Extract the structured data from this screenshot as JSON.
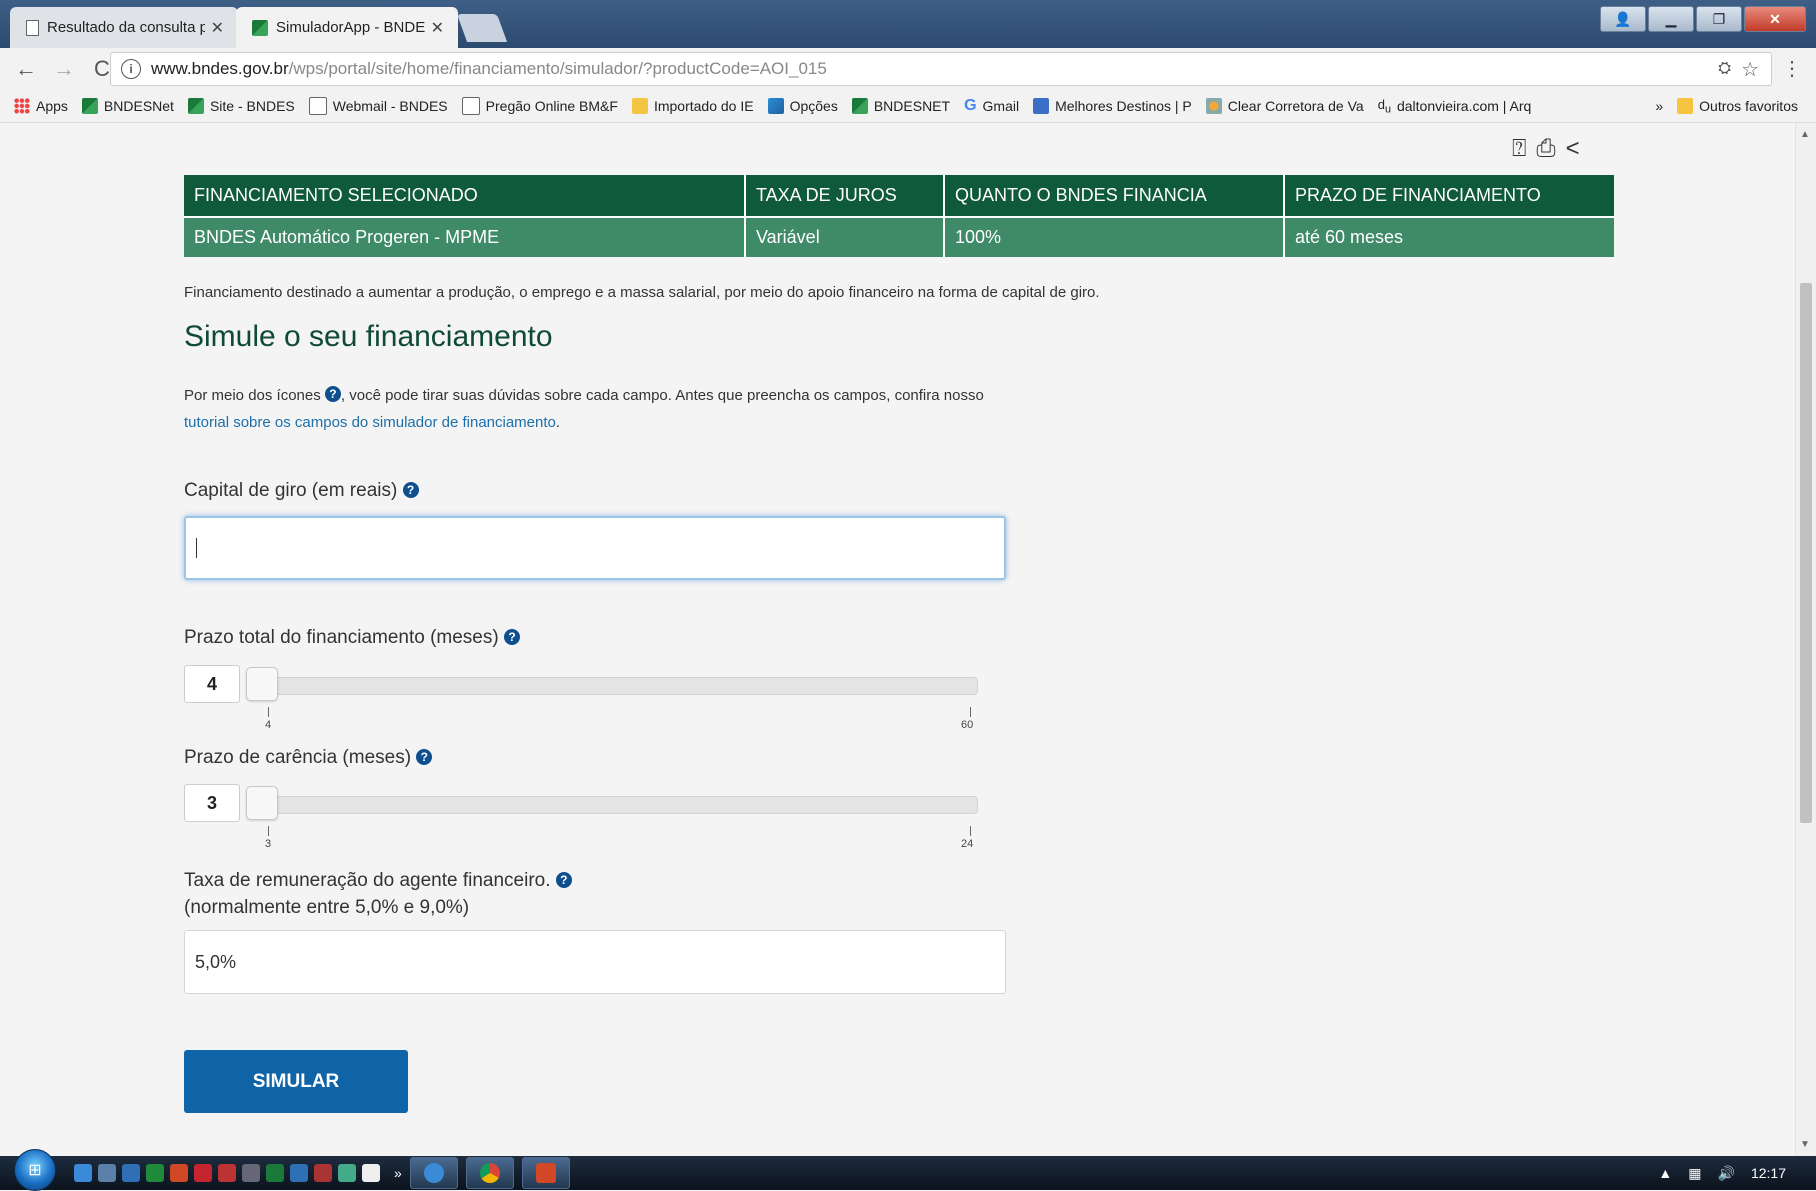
{
  "browser": {
    "tabs": [
      {
        "title": "Resultado da consulta pr",
        "active": false
      },
      {
        "title": "SimuladorApp - BNDES",
        "active": true
      }
    ],
    "url_host": "www.bndes.gov.br",
    "url_path": "/wps/portal/site/home/financiamento/simulador/?productCode=AOI_015",
    "bookmarks": [
      {
        "label": "Apps",
        "icon": "apps-grid-icon"
      },
      {
        "label": "BNDESNet",
        "icon": "bndes-icon"
      },
      {
        "label": "Site - BNDES",
        "icon": "bndes-icon"
      },
      {
        "label": "Webmail - BNDES",
        "icon": "page-icon"
      },
      {
        "label": "Pregão Online  BM&F",
        "icon": "page-icon"
      },
      {
        "label": "Importado do IE",
        "icon": "folder-icon"
      },
      {
        "label": "Opções",
        "icon": "chart-icon"
      },
      {
        "label": "BNDESNET",
        "icon": "bndes-icon"
      },
      {
        "label": "Gmail",
        "icon": "google-icon"
      },
      {
        "label": "Melhores Destinos | P",
        "icon": "pin-icon"
      },
      {
        "label": "Clear Corretora de Va",
        "icon": "clear-icon"
      },
      {
        "label": "daltonvieira.com | Arq",
        "icon": "du-icon"
      }
    ],
    "bookmarks_overflow": "»",
    "other_bookmarks": "Outros favoritos"
  },
  "table": {
    "headers": [
      "FINANCIAMENTO SELECIONADO",
      "TAXA DE JUROS",
      "QUANTO O BNDES FINANCIA",
      "PRAZO DE FINANCIAMENTO"
    ],
    "row": [
      "BNDES Automático Progeren - MPME",
      "Variável",
      "100%",
      "até 60 meses"
    ]
  },
  "content": {
    "description": "Financiamento destinado a aumentar a produção, o emprego e a massa salarial, por meio do apoio financeiro na forma de capital de giro.",
    "heading": "Simule o seu financiamento",
    "intro_before": "Por meio dos ícones ",
    "intro_after": ", você pode tirar suas dúvidas sobre cada campo. Antes que preencha os campos, confira nosso",
    "intro_link": "tutorial sobre os campos do simulador de financiamento",
    "intro_end": "."
  },
  "form": {
    "capital_label": "Capital de giro (em reais)",
    "capital_value": "",
    "prazo_label": "Prazo total do financiamento (meses)",
    "prazo": {
      "value": "4",
      "min": "4",
      "max": "60"
    },
    "carencia_label": "Prazo de carência (meses)",
    "carencia": {
      "value": "3",
      "min": "3",
      "max": "24"
    },
    "taxa_label_1": "Taxa de remuneração do agente financeiro.",
    "taxa_label_2": "(normalmente entre 5,0% e 9,0%)",
    "taxa_value": "5,0%",
    "submit_label": "SIMULAR"
  },
  "taskbar": {
    "clock": "12:17"
  },
  "colors": {
    "table_header": "#0f5a3a",
    "table_row": "#3f8a67",
    "button": "#0f64a8",
    "heading": "#0f4a33",
    "help_icon": "#0d4f8f"
  }
}
